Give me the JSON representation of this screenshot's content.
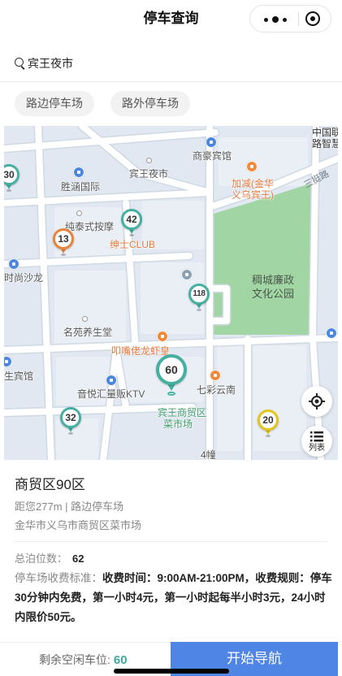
{
  "header": {
    "title": "停车查询",
    "capsule_icons": [
      "more-dots-icon",
      "target-circle-icon"
    ]
  },
  "search": {
    "icon": "search-icon",
    "value": "宾王夜市"
  },
  "filters": [
    {
      "label": "路边停车场"
    },
    {
      "label": "路外停车场"
    }
  ],
  "map": {
    "park": [
      "稠城廉政",
      "文化公园"
    ],
    "road": "三挺路",
    "pois": [
      {
        "lines": [
          "商豪宾馆"
        ],
        "icon": "hotel-icon"
      },
      {
        "lines": [
          "宾王夜市"
        ],
        "icon": "poi-dot-icon"
      },
      {
        "lines": [
          "胜涵国际"
        ],
        "icon": "building-icon"
      },
      {
        "lines": [
          "加减(金华",
          "义乌宾王)"
        ],
        "icon": "restaurant-icon"
      },
      {
        "lines": [
          "中国联",
          "路智慧"
        ]
      },
      {
        "lines": [
          "纯泰式按摩"
        ],
        "icon": "poi-dot-icon"
      },
      {
        "lines": [
          "绅士CLUB"
        ]
      },
      {
        "lines": [
          "时尚沙龙"
        ],
        "icon": "salon-icon"
      },
      {
        "lines": [
          "名苑养生堂"
        ],
        "icon": "poi-dot-icon"
      },
      {
        "lines": [
          "叩嘴佬龙虾皇"
        ],
        "icon": "restaurant-icon"
      },
      {
        "lines": [
          "生宾馆"
        ],
        "icon": "hotel-icon"
      },
      {
        "lines": [
          "音悦汇量贩KTV"
        ],
        "icon": "ktv-icon"
      },
      {
        "lines": [
          "七彩云南"
        ],
        "icon": "shop-icon"
      },
      {
        "lines": [
          "宾王商贸区",
          "菜市场"
        ]
      },
      {
        "lines": [
          "4幢"
        ]
      }
    ],
    "markers": [
      {
        "value": "30",
        "color": "#45b0a2"
      },
      {
        "value": "42",
        "color": "#45b0a2"
      },
      {
        "value": "13",
        "color": "#e8843a"
      },
      {
        "value": "118",
        "color": "#45b0a2"
      },
      {
        "value": "60",
        "color": "#45b0a2",
        "selected": true
      },
      {
        "value": "32",
        "color": "#45b0a2"
      },
      {
        "value": "20",
        "color": "#e2c51d"
      }
    ],
    "controls": {
      "locate_icon": "locate-crosshair-icon",
      "list_icon": "list-icon",
      "list_label": "列表"
    }
  },
  "lot": {
    "name": "商贸区90区",
    "distance_type": "距您277m | 路边停车场",
    "address": "金华市义乌市商贸区菜市场",
    "total_label": "总泊位数：",
    "total_value": "62",
    "fee_label": "停车场收费标准：",
    "fee_text": "收费时间：9:00AM-21:00PM，收费规则：停车30分钟内免费，第一小时4元，第一小时起每半小时3元，24小时内限价50元。"
  },
  "footer": {
    "free_label": "剩余空闲车位:",
    "free_value": "60",
    "nav_button": "开始导航"
  },
  "colors": {
    "primary_button": "#4f85e5",
    "free_count": "#3aa99b",
    "park": "#a1d5a4"
  }
}
